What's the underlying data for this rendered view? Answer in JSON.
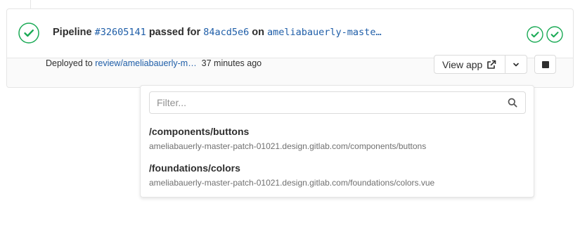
{
  "pipeline": {
    "label": "Pipeline",
    "id": "#32605141",
    "passed_text": "passed for",
    "commit": "84acd5e6",
    "on_text": "on",
    "branch": "ameliabauerly-maste…",
    "status": "passed",
    "status_color": "#1aaa55",
    "stages": [
      {
        "status": "passed",
        "icon": "check-circle-icon"
      },
      {
        "status": "passed",
        "icon": "check-circle-icon"
      }
    ]
  },
  "deployment": {
    "deployed_to_text": "Deployed to",
    "environment": "review/ameliabauerly-m…",
    "time_ago": "37 minutes ago"
  },
  "actions": {
    "view_app_label": "View app",
    "view_app_icon": "external-link-icon",
    "dropdown_icon": "chevron-down-icon",
    "stop_icon": "stop-icon"
  },
  "dropdown": {
    "filter_placeholder": "Filter...",
    "items": [
      {
        "path": "/components/buttons",
        "url": "ameliabauerly-master-patch-01021.design.gitlab.com/components/buttons"
      },
      {
        "path": "/foundations/colors",
        "url": "ameliabauerly-master-patch-01021.design.gitlab.com/foundations/colors.vue"
      }
    ]
  },
  "colors": {
    "success": "#1aaa55",
    "link": "#1f5ea8",
    "border": "#dbdbdb"
  }
}
